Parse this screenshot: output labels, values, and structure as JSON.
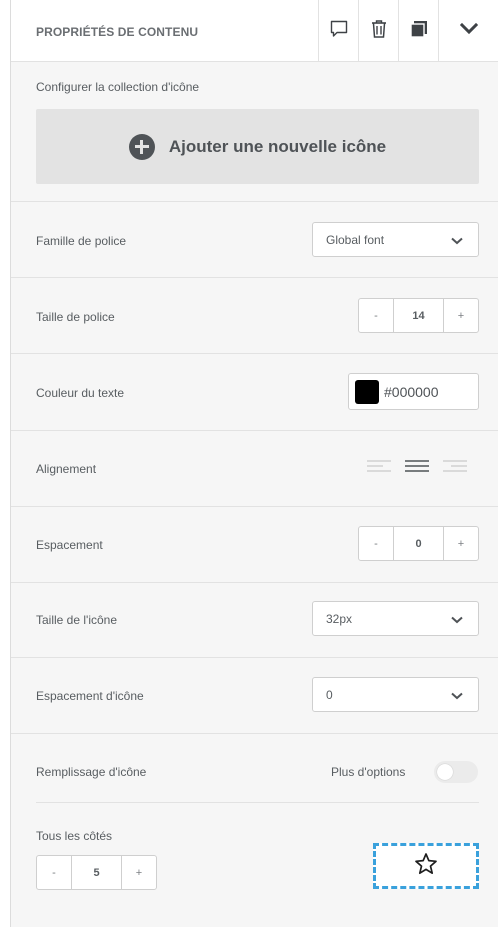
{
  "header": {
    "title": "PROPRIÉTÉS DE CONTENU",
    "icons": [
      "comment-icon",
      "trash-icon",
      "duplicate-icon",
      "chevron-down-icon"
    ]
  },
  "collection": {
    "label": "Configurer la collection d'icône",
    "add_button": "Ajouter une nouvelle icône"
  },
  "font_family": {
    "label": "Famille de police",
    "value": "Global font"
  },
  "font_size": {
    "label": "Taille de police",
    "minus": "-",
    "value": "14",
    "plus": "+"
  },
  "text_color": {
    "label": "Couleur du texte",
    "value": "#000000",
    "swatch": "#000000"
  },
  "alignment": {
    "label": "Alignement",
    "options": [
      "align-left-icon",
      "align-center-icon",
      "align-right-icon"
    ],
    "selected": "center"
  },
  "spacing": {
    "label": "Espacement",
    "minus": "-",
    "value": "0",
    "plus": "+"
  },
  "icon_size": {
    "label": "Taille de l'icône",
    "value": "32px"
  },
  "icon_spacing": {
    "label": "Espacement d'icône",
    "value": "0"
  },
  "icon_padding": {
    "label": "Remplissage d'icône",
    "more_options_label": "Plus d'options",
    "more_options_on": false,
    "all_sides_label": "Tous les côtés",
    "minus": "-",
    "value": "5",
    "plus": "+"
  },
  "preview": {
    "icon": "star-outline-icon",
    "border_color": "#3aa1dc"
  }
}
